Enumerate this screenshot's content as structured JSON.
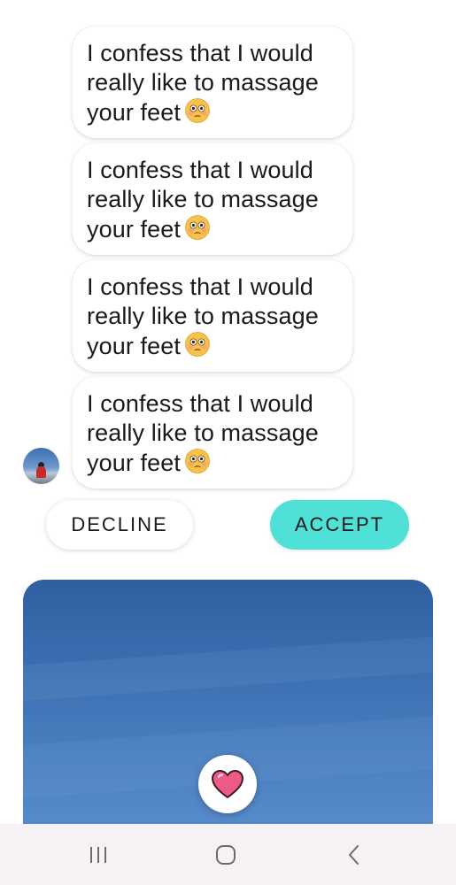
{
  "messages": [
    {
      "text": "I confess that I would really like to massage your feet",
      "emoji": "flushed-face-emoji"
    },
    {
      "text": "I confess that I would really like to massage your feet",
      "emoji": "flushed-face-emoji"
    },
    {
      "text": "I confess that I would really like to massage your feet",
      "emoji": "flushed-face-emoji"
    },
    {
      "text": "I confess that I would really like to massage your feet",
      "emoji": "flushed-face-emoji"
    }
  ],
  "actions": {
    "decline_label": "DECLINE",
    "accept_label": "ACCEPT"
  },
  "colors": {
    "accept": "#4fe0d8",
    "heart": "#ee5a86",
    "navbar": "#f6f1f4"
  },
  "icons": {
    "like": "heart-icon",
    "recents": "recent-apps-icon",
    "home": "home-icon",
    "back": "back-icon"
  }
}
